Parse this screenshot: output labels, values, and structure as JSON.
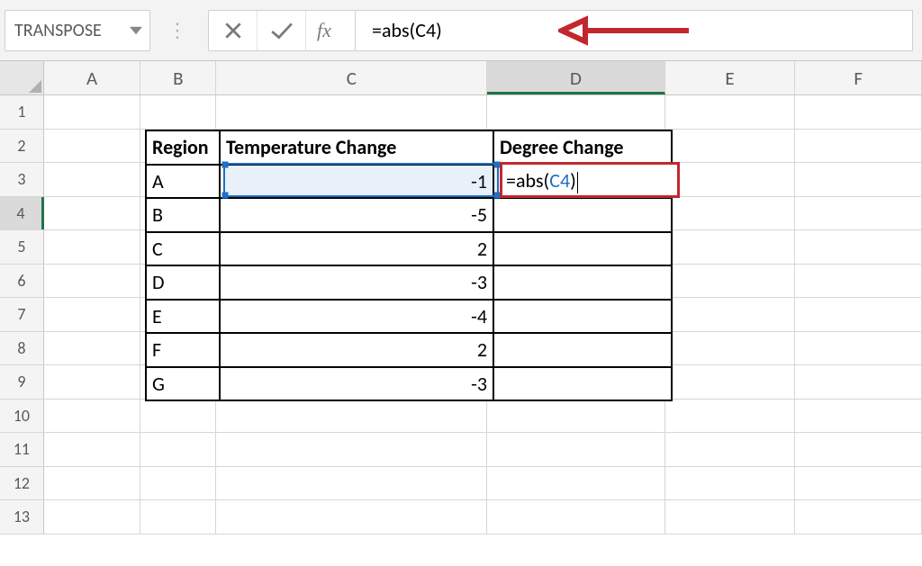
{
  "formula_bar": {
    "name_box_value": "TRANSPOSE",
    "formula_value": "=abs(C4)"
  },
  "columns": [
    "A",
    "B",
    "C",
    "D",
    "E",
    "F"
  ],
  "row_count": 13,
  "active_cell": {
    "row": 4,
    "col": "D"
  },
  "referenced_cell": {
    "row": 4,
    "col": "C"
  },
  "editing_text_parts": {
    "prefix": "=abs(",
    "ref": "C4",
    "suffix": ")"
  },
  "table": {
    "headers": {
      "region": "Region",
      "temp": "Temperature Change",
      "degree": "Degree Change"
    },
    "rows": [
      {
        "region": "A",
        "temp": -1,
        "degree": ""
      },
      {
        "region": "B",
        "temp": -5,
        "degree": ""
      },
      {
        "region": "C",
        "temp": 2,
        "degree": ""
      },
      {
        "region": "D",
        "temp": -3,
        "degree": ""
      },
      {
        "region": "E",
        "temp": -4,
        "degree": ""
      },
      {
        "region": "F",
        "temp": 2,
        "degree": ""
      },
      {
        "region": "G",
        "temp": -3,
        "degree": ""
      }
    ]
  },
  "annotation": {
    "arrow_color": "#c1272d"
  }
}
